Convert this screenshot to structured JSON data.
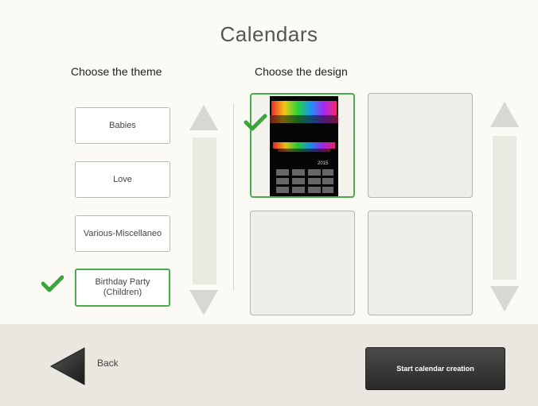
{
  "page": {
    "title": "Calendars"
  },
  "themes": {
    "header": "Choose the theme",
    "items": [
      {
        "label": "Babies",
        "selected": false
      },
      {
        "label": "Love",
        "selected": false
      },
      {
        "label": "Various-Miscellaneo",
        "selected": false
      },
      {
        "label": "Birthday Party\n(Children)",
        "selected": true
      }
    ]
  },
  "designs": {
    "header": "Choose the design",
    "items": [
      {
        "selected": true,
        "thumbnail_year": "2015"
      },
      {
        "selected": false
      },
      {
        "selected": false
      },
      {
        "selected": false
      }
    ]
  },
  "footer": {
    "back_label": "Back",
    "start_label": "Start calendar creation"
  },
  "colors": {
    "accent_green": "#4caa4c",
    "footer_bg": "#e9e7df",
    "start_button_bg": "#2f2f2d"
  },
  "icons": {
    "check": "checkmark-icon",
    "up": "arrow-up-icon",
    "down": "arrow-down-icon",
    "back": "arrow-left-icon"
  }
}
